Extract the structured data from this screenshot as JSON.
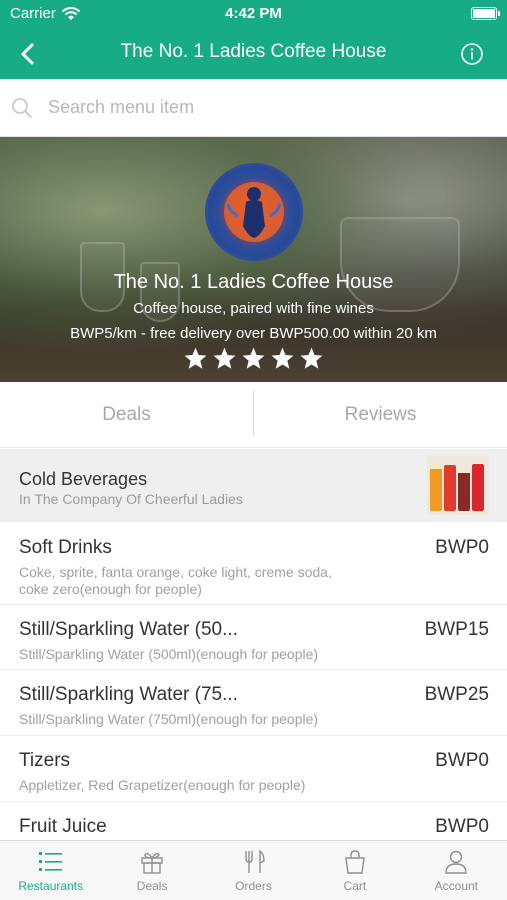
{
  "status_bar": {
    "carrier": "Carrier",
    "time": "4:42 PM"
  },
  "nav": {
    "title": "The No. 1 Ladies Coffee House"
  },
  "search": {
    "placeholder": "Search menu item",
    "value": ""
  },
  "hero": {
    "name": "The No. 1 Ladies Coffee House",
    "tagline": "Coffee house, paired with fine wines",
    "delivery": "BWP5/km - free delivery over BWP500.00 within 20 km",
    "rating": 5,
    "rating_max": 5
  },
  "tabs": {
    "deals": "Deals",
    "reviews": "Reviews"
  },
  "category": {
    "title": "Cold Beverages",
    "subtitle": "In The Company Of Cheerful Ladies"
  },
  "menu_items": [
    {
      "name": "Soft Drinks",
      "price": "BWP0",
      "description": "Coke, sprite, fanta orange, coke light, creme soda, coke zero(enough for  people)"
    },
    {
      "name": "Still/Sparkling Water (50...",
      "price": "BWP15",
      "description": "Still/Sparkling Water (500ml)(enough for  people)"
    },
    {
      "name": "Still/Sparkling Water (75...",
      "price": "BWP25",
      "description": "Still/Sparkling Water (750ml)(enough for  people)"
    },
    {
      "name": "Tizers",
      "price": "BWP0",
      "description": "Appletizer, Red Grapetizer(enough for  people)"
    },
    {
      "name": "Fruit Juice",
      "price": "BWP0",
      "description": ""
    }
  ],
  "tabbar": {
    "restaurants": "Restaurants",
    "deals": "Deals",
    "orders": "Orders",
    "cart": "Cart",
    "account": "Account"
  },
  "colors": {
    "brand": "#17ac84",
    "inactive": "#8e8e8e"
  },
  "icons": {
    "status": [
      "wifi-icon",
      "battery-icon"
    ],
    "nav": [
      "back-icon",
      "info-icon"
    ],
    "search": "search-icon",
    "tabbar": [
      "restaurants-icon",
      "gift-icon",
      "orders-icon",
      "cart-icon",
      "account-icon"
    ]
  }
}
